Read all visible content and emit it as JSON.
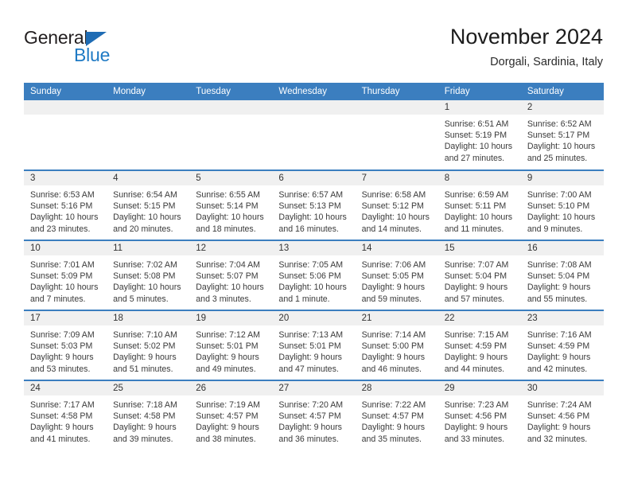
{
  "brand": {
    "name_part1": "General",
    "name_part2": "Blue",
    "accent_color": "#1f7ac4",
    "triangle_color": "#1f6cb4"
  },
  "header": {
    "title": "November 2024",
    "subtitle": "Dorgali, Sardinia, Italy"
  },
  "theme": {
    "header_row_bg": "#3b7ebf",
    "daynum_band_bg": "#f0f0f0",
    "row_divider": "#3b7ebf",
    "text": "#3a3a3a"
  },
  "weekdays": [
    "Sunday",
    "Monday",
    "Tuesday",
    "Wednesday",
    "Thursday",
    "Friday",
    "Saturday"
  ],
  "labels": {
    "sunrise": "Sunrise:",
    "sunset": "Sunset:",
    "daylight": "Daylight:"
  },
  "weeks": [
    [
      {
        "day": "",
        "sunrise": "",
        "sunset": "",
        "daylight": ""
      },
      {
        "day": "",
        "sunrise": "",
        "sunset": "",
        "daylight": ""
      },
      {
        "day": "",
        "sunrise": "",
        "sunset": "",
        "daylight": ""
      },
      {
        "day": "",
        "sunrise": "",
        "sunset": "",
        "daylight": ""
      },
      {
        "day": "",
        "sunrise": "",
        "sunset": "",
        "daylight": ""
      },
      {
        "day": "1",
        "sunrise": "Sunrise: 6:51 AM",
        "sunset": "Sunset: 5:19 PM",
        "daylight": "Daylight: 10 hours and 27 minutes."
      },
      {
        "day": "2",
        "sunrise": "Sunrise: 6:52 AM",
        "sunset": "Sunset: 5:17 PM",
        "daylight": "Daylight: 10 hours and 25 minutes."
      }
    ],
    [
      {
        "day": "3",
        "sunrise": "Sunrise: 6:53 AM",
        "sunset": "Sunset: 5:16 PM",
        "daylight": "Daylight: 10 hours and 23 minutes."
      },
      {
        "day": "4",
        "sunrise": "Sunrise: 6:54 AM",
        "sunset": "Sunset: 5:15 PM",
        "daylight": "Daylight: 10 hours and 20 minutes."
      },
      {
        "day": "5",
        "sunrise": "Sunrise: 6:55 AM",
        "sunset": "Sunset: 5:14 PM",
        "daylight": "Daylight: 10 hours and 18 minutes."
      },
      {
        "day": "6",
        "sunrise": "Sunrise: 6:57 AM",
        "sunset": "Sunset: 5:13 PM",
        "daylight": "Daylight: 10 hours and 16 minutes."
      },
      {
        "day": "7",
        "sunrise": "Sunrise: 6:58 AM",
        "sunset": "Sunset: 5:12 PM",
        "daylight": "Daylight: 10 hours and 14 minutes."
      },
      {
        "day": "8",
        "sunrise": "Sunrise: 6:59 AM",
        "sunset": "Sunset: 5:11 PM",
        "daylight": "Daylight: 10 hours and 11 minutes."
      },
      {
        "day": "9",
        "sunrise": "Sunrise: 7:00 AM",
        "sunset": "Sunset: 5:10 PM",
        "daylight": "Daylight: 10 hours and 9 minutes."
      }
    ],
    [
      {
        "day": "10",
        "sunrise": "Sunrise: 7:01 AM",
        "sunset": "Sunset: 5:09 PM",
        "daylight": "Daylight: 10 hours and 7 minutes."
      },
      {
        "day": "11",
        "sunrise": "Sunrise: 7:02 AM",
        "sunset": "Sunset: 5:08 PM",
        "daylight": "Daylight: 10 hours and 5 minutes."
      },
      {
        "day": "12",
        "sunrise": "Sunrise: 7:04 AM",
        "sunset": "Sunset: 5:07 PM",
        "daylight": "Daylight: 10 hours and 3 minutes."
      },
      {
        "day": "13",
        "sunrise": "Sunrise: 7:05 AM",
        "sunset": "Sunset: 5:06 PM",
        "daylight": "Daylight: 10 hours and 1 minute."
      },
      {
        "day": "14",
        "sunrise": "Sunrise: 7:06 AM",
        "sunset": "Sunset: 5:05 PM",
        "daylight": "Daylight: 9 hours and 59 minutes."
      },
      {
        "day": "15",
        "sunrise": "Sunrise: 7:07 AM",
        "sunset": "Sunset: 5:04 PM",
        "daylight": "Daylight: 9 hours and 57 minutes."
      },
      {
        "day": "16",
        "sunrise": "Sunrise: 7:08 AM",
        "sunset": "Sunset: 5:04 PM",
        "daylight": "Daylight: 9 hours and 55 minutes."
      }
    ],
    [
      {
        "day": "17",
        "sunrise": "Sunrise: 7:09 AM",
        "sunset": "Sunset: 5:03 PM",
        "daylight": "Daylight: 9 hours and 53 minutes."
      },
      {
        "day": "18",
        "sunrise": "Sunrise: 7:10 AM",
        "sunset": "Sunset: 5:02 PM",
        "daylight": "Daylight: 9 hours and 51 minutes."
      },
      {
        "day": "19",
        "sunrise": "Sunrise: 7:12 AM",
        "sunset": "Sunset: 5:01 PM",
        "daylight": "Daylight: 9 hours and 49 minutes."
      },
      {
        "day": "20",
        "sunrise": "Sunrise: 7:13 AM",
        "sunset": "Sunset: 5:01 PM",
        "daylight": "Daylight: 9 hours and 47 minutes."
      },
      {
        "day": "21",
        "sunrise": "Sunrise: 7:14 AM",
        "sunset": "Sunset: 5:00 PM",
        "daylight": "Daylight: 9 hours and 46 minutes."
      },
      {
        "day": "22",
        "sunrise": "Sunrise: 7:15 AM",
        "sunset": "Sunset: 4:59 PM",
        "daylight": "Daylight: 9 hours and 44 minutes."
      },
      {
        "day": "23",
        "sunrise": "Sunrise: 7:16 AM",
        "sunset": "Sunset: 4:59 PM",
        "daylight": "Daylight: 9 hours and 42 minutes."
      }
    ],
    [
      {
        "day": "24",
        "sunrise": "Sunrise: 7:17 AM",
        "sunset": "Sunset: 4:58 PM",
        "daylight": "Daylight: 9 hours and 41 minutes."
      },
      {
        "day": "25",
        "sunrise": "Sunrise: 7:18 AM",
        "sunset": "Sunset: 4:58 PM",
        "daylight": "Daylight: 9 hours and 39 minutes."
      },
      {
        "day": "26",
        "sunrise": "Sunrise: 7:19 AM",
        "sunset": "Sunset: 4:57 PM",
        "daylight": "Daylight: 9 hours and 38 minutes."
      },
      {
        "day": "27",
        "sunrise": "Sunrise: 7:20 AM",
        "sunset": "Sunset: 4:57 PM",
        "daylight": "Daylight: 9 hours and 36 minutes."
      },
      {
        "day": "28",
        "sunrise": "Sunrise: 7:22 AM",
        "sunset": "Sunset: 4:57 PM",
        "daylight": "Daylight: 9 hours and 35 minutes."
      },
      {
        "day": "29",
        "sunrise": "Sunrise: 7:23 AM",
        "sunset": "Sunset: 4:56 PM",
        "daylight": "Daylight: 9 hours and 33 minutes."
      },
      {
        "day": "30",
        "sunrise": "Sunrise: 7:24 AM",
        "sunset": "Sunset: 4:56 PM",
        "daylight": "Daylight: 9 hours and 32 minutes."
      }
    ]
  ]
}
